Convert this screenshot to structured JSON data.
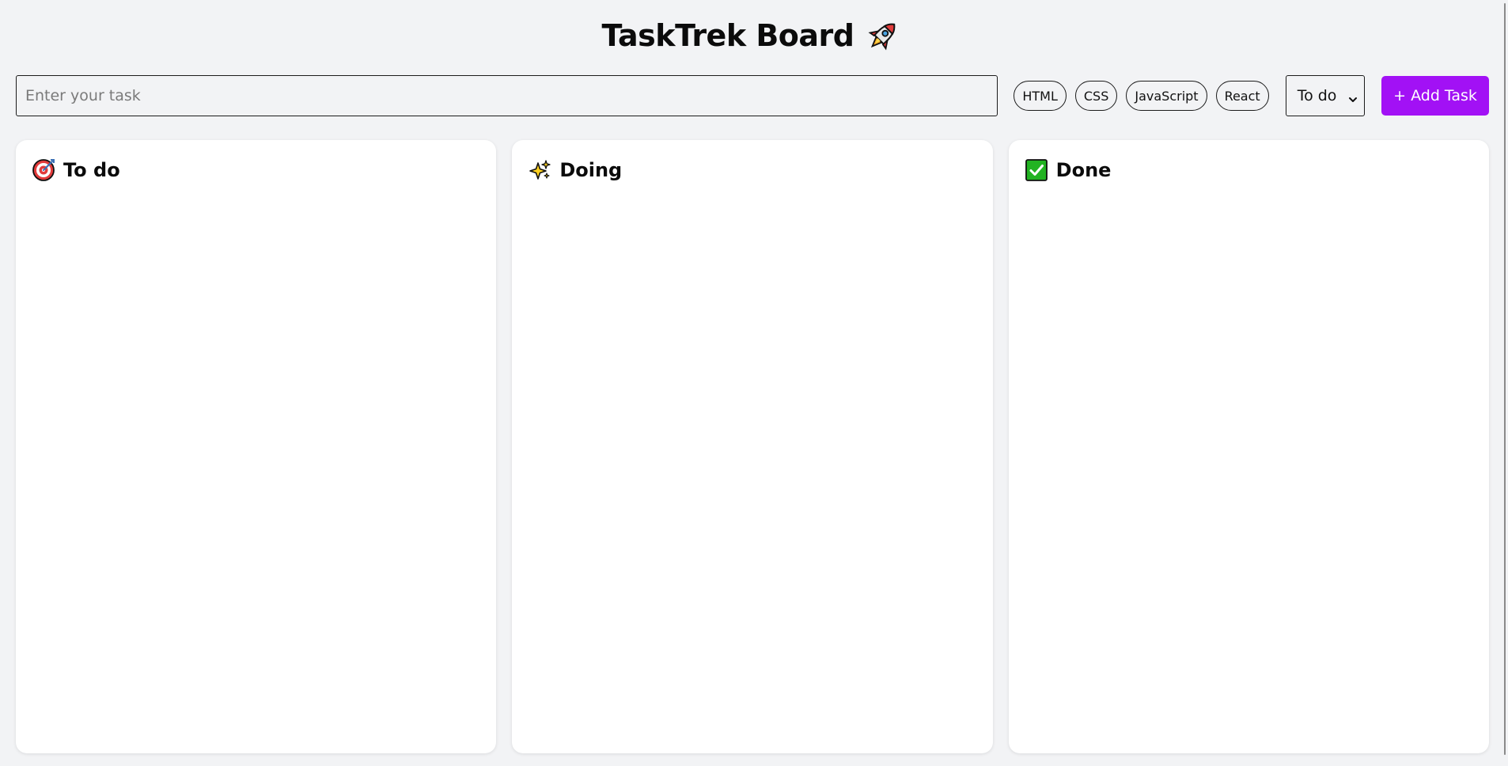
{
  "header": {
    "title": "TaskTrek Board",
    "icon": "rocket-icon"
  },
  "toolbar": {
    "task_input": {
      "placeholder": "Enter your task",
      "value": ""
    },
    "tags": [
      {
        "label": "HTML"
      },
      {
        "label": "CSS"
      },
      {
        "label": "JavaScript"
      },
      {
        "label": "React"
      }
    ],
    "status_select": {
      "selected": "To do",
      "icon": "chevron-down-icon"
    },
    "add_button": {
      "label": "+ Add Task"
    }
  },
  "columns": [
    {
      "title": "To do",
      "icon": "target-icon",
      "tasks": []
    },
    {
      "title": "Doing",
      "icon": "sparkles-icon",
      "tasks": []
    },
    {
      "title": "Done",
      "icon": "check-mark-icon",
      "tasks": []
    }
  ],
  "colors": {
    "accent": "#a211f5",
    "background": "#f2f3f5",
    "card": "#ffffff",
    "done_check": "#22b322"
  }
}
